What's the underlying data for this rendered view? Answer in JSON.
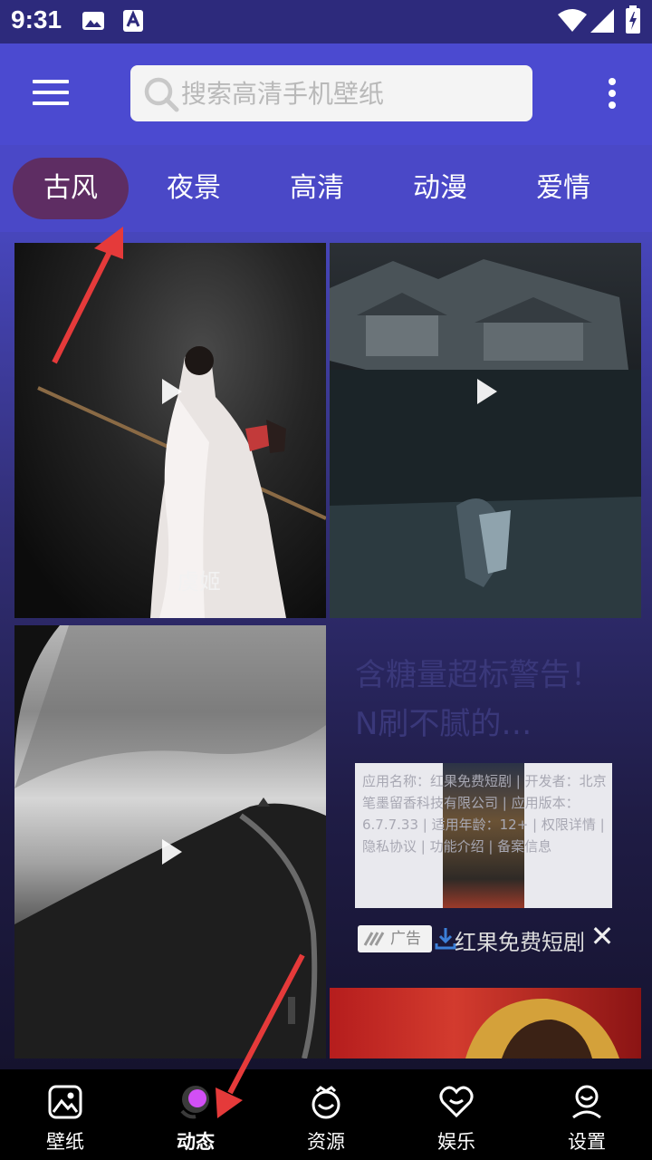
{
  "status_bar": {
    "time": "9:31"
  },
  "search": {
    "placeholder": "搜索高清手机壁纸"
  },
  "tabs": [
    {
      "label": "古风",
      "active": true
    },
    {
      "label": "夜景"
    },
    {
      "label": "高清"
    },
    {
      "label": "动漫"
    },
    {
      "label": "爱情"
    }
  ],
  "feed": {
    "card1_caption": "虞姬",
    "ad": {
      "title": "含糖量超标警告！N刷不腻的…",
      "info": "应用名称：红果免费短剧 | 开发者：北京笔墨留香科技有限公司 | 应用版本：6.7.7.33 | 适用年龄：12+ | 权限详情 | 隐私协议 | 功能介绍 | 备案信息",
      "badge": "广告",
      "app_name": "红果免费短剧",
      "close": "✕"
    }
  },
  "bottom_nav": [
    {
      "label": "壁纸",
      "icon": "image-icon"
    },
    {
      "label": "动态",
      "icon": "live-icon",
      "active": true
    },
    {
      "label": "资源",
      "icon": "resource-icon"
    },
    {
      "label": "娱乐",
      "icon": "heart-icon"
    },
    {
      "label": "设置",
      "icon": "settings-icon"
    }
  ],
  "colors": {
    "accent": "#4b4ad0",
    "active_tab": "#5e2d63",
    "arrow": "#e53a3a"
  }
}
